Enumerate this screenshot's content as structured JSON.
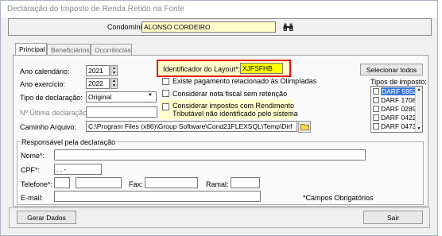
{
  "window": {
    "title": "Declaração do Imposto de Renda Retido na Fonte"
  },
  "condominio": {
    "label": "Condomínio:",
    "value": "ALONSO CORDEIRO",
    "search_icon": "binoculars-icon"
  },
  "tabs": [
    {
      "label": "Principal",
      "active": true
    },
    {
      "label": "Beneficiários",
      "active": false
    },
    {
      "label": "Ocorrências",
      "active": false
    }
  ],
  "form": {
    "ano_calendario": {
      "label": "Ano calendário:",
      "value": "2021"
    },
    "ano_exercicio": {
      "label": "Ano exercício:",
      "value": "2022"
    },
    "tipo_declaracao": {
      "label": "Tipo de declaração:",
      "value": "Original"
    },
    "ultima_declaracao": {
      "label": "Nº Última declaração*:",
      "value": ""
    },
    "caminho": {
      "label": "Caminho Arquivo:",
      "value": "C:\\Program Files (x86)\\Group Software\\Cond21FLEXSQL\\Temp\\Dirf",
      "folder_icon": "folder-icon"
    },
    "identificador": {
      "label": "Identificador do Layout*:",
      "value": "XJFSFHB"
    },
    "checks": [
      "Existe pagamento relacionado às Olimpíadas",
      "Considerar nota fiscal sem retenção"
    ],
    "considerar_impostos": {
      "line1": "Considerar impostos com Rendimento",
      "line2": "Tributável não identificado pelo sistema"
    }
  },
  "impostos": {
    "select_all_label": "Selecionar todos",
    "label": "Tipos de imposto:",
    "items": [
      "DARF 5952",
      "DARF 1708",
      "DARF 0289",
      "DARF 0422",
      "DARF 0473"
    ]
  },
  "responsavel": {
    "title": "Responsável pela declaração",
    "nome_label": "Nome*:",
    "cpf_label": "CPF*:",
    "cpf_value": ".   .   -",
    "telefone_label": "Telefone*:",
    "fax_label": "Fax:",
    "ramal_label": "Ramal:",
    "email_label": "E-mail:",
    "required_note": "*Campos Obrigatórios"
  },
  "buttons": {
    "gerar": "Gerar Dados",
    "sair": "Sair"
  },
  "colors": {
    "highlight_border": "#e81010",
    "yellow_bg": "#ffffcc",
    "selection": "#3c78d8"
  }
}
